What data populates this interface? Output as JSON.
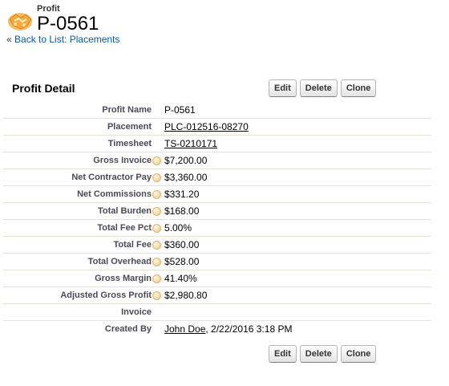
{
  "header": {
    "object_type": "Profit",
    "record_name": "P-0561",
    "icon": "handshake-icon"
  },
  "breadcrumb": {
    "arrow": "«",
    "back_label": "Back to List: Placements"
  },
  "detail": {
    "title": "Profit Detail",
    "buttons": {
      "edit": "Edit",
      "delete": "Delete",
      "clone": "Clone"
    },
    "fields": [
      {
        "label": "Profit Name",
        "value": "P-0561"
      },
      {
        "label": "Placement",
        "value": "PLC-012516-08270"
      },
      {
        "label": "Timesheet",
        "value": "TS-0210171"
      },
      {
        "label": "Gross Invoice",
        "value": "$7,200.00"
      },
      {
        "label": "Net Contractor Pay",
        "value": "$3,360.00"
      },
      {
        "label": "Net Commissions",
        "value": "$331.20"
      },
      {
        "label": "Total Burden",
        "value": "$168.00"
      },
      {
        "label": "Total Fee Pct",
        "value": "5.00%"
      },
      {
        "label": "Total Fee",
        "value": "$360.00"
      },
      {
        "label": "Total Overhead",
        "value": "$528.00"
      },
      {
        "label": "Gross Margin",
        "value": "41.40%"
      },
      {
        "label": "Adjusted Gross Profit",
        "value": "$2,980.80"
      },
      {
        "label": "Invoice",
        "value": ""
      },
      {
        "label": "Created By",
        "user": "John Doe",
        "date": ", 2/22/2016 3:18 PM"
      }
    ]
  },
  "colors": {
    "link": "#015ba7",
    "label": "#4a4a56",
    "row_border": "#e3e3d7",
    "help_icon": "#e8c98a"
  }
}
